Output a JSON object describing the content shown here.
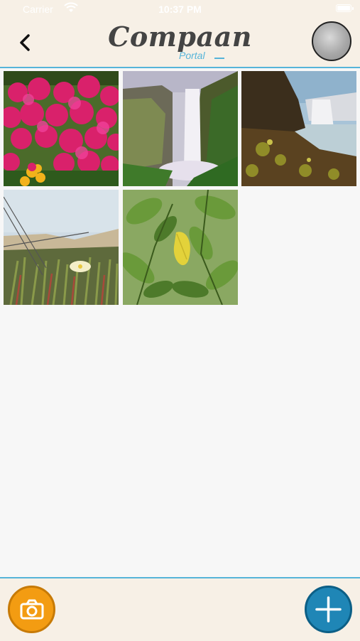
{
  "status_bar": {
    "carrier": "Carrier",
    "time": "10:37 PM"
  },
  "header": {
    "logo_text": "Compaan",
    "logo_subtext": "Portal"
  },
  "gallery": {
    "photos": [
      {
        "subject": "magenta flowers"
      },
      {
        "subject": "waterfall cliff"
      },
      {
        "subject": "waterfall rocks"
      },
      {
        "subject": "grass dunes flower"
      },
      {
        "subject": "green leaves"
      }
    ]
  },
  "colors": {
    "accent": "#56b4d9",
    "bar_bg": "#f7f0e6",
    "camera": "#f39c12",
    "add": "#1f86b6"
  },
  "icons": {
    "back": "chevron-left-icon",
    "camera": "camera-icon",
    "add": "plus-icon"
  }
}
